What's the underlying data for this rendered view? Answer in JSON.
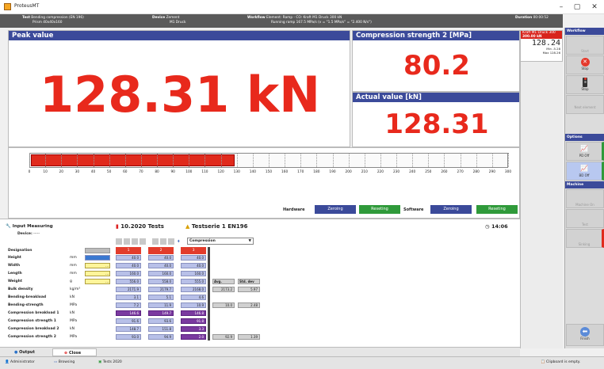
{
  "app": {
    "title": "ProteusMT"
  },
  "infobar": {
    "test_label": "Test",
    "test_value": "Bending compression (EN 196)",
    "test_sub": "Prism 40x40x160",
    "device_label": "Device",
    "device_value": "Zement",
    "device_sub": "M1 Druck",
    "workflow_label": "Workflow",
    "workflow_value": "Element: Ramp - CO: Kraft M1 Druck 300 kN",
    "workflow_sub": "Running ramp 167.5 MPa/s (v = \"1.5 MPa/s\" = \"2.400 N/s\")",
    "duration_label": "Duration",
    "duration_value": "00:00:52"
  },
  "peak": {
    "title": "Peak value",
    "value": "128.31 kN"
  },
  "compression": {
    "title": "Compression strength 2 [MPa]",
    "value": "80.2"
  },
  "actual": {
    "title": "Actual value [kN]",
    "value": "128.31"
  },
  "progress": {
    "fraction": 0.4277,
    "ticks": [
      "0",
      "10",
      "20",
      "30",
      "40",
      "50",
      "60",
      "70",
      "80",
      "90",
      "100",
      "110",
      "120",
      "130",
      "140",
      "150",
      "160",
      "170",
      "180",
      "190",
      "200",
      "210",
      "220",
      "230",
      "240",
      "250",
      "260",
      "270",
      "280",
      "290",
      "300"
    ]
  },
  "controls": {
    "hardware": "Hardware",
    "hw_zeroing": "Zeroing",
    "hw_reseting": "Reseting",
    "software": "Software",
    "sw_zeroing": "Zeroing",
    "sw_reseting": "Reseting"
  },
  "sensor": {
    "name": "Kraft M1 Druck 300",
    "range": "300.00 kN",
    "digits": "128.24",
    "min_label": "Min",
    "min": "-5.28",
    "max_label": "Max",
    "max": "128.26"
  },
  "workflow": {
    "title": "Workflow",
    "start": "Start",
    "stop1": "Stop",
    "stop2": "Stop",
    "next": "Next element",
    "options": "Options",
    "pd_off": "PD Off",
    "bd_off": "BD Off",
    "machine": "Machine",
    "machine_on": "Machine On",
    "test": "Test",
    "sinking": "Sinking",
    "finish": "Finish"
  },
  "input": {
    "title": "Input Measuring",
    "device_label": "Device:",
    "device_value": "-----"
  },
  "tests": {
    "title": "10.2020 Tests",
    "series": "Testserie 1 EN196",
    "time": "14:06",
    "dropdown": "Compression"
  },
  "table": {
    "designation": "Designation",
    "cols": [
      "1",
      "2",
      "3"
    ],
    "avg": "Avg.",
    "std": "Std. dev",
    "rows": [
      {
        "label": "Height",
        "unit": "mm",
        "v": [
          "40.0",
          "40.0",
          "40.0"
        ],
        "avg": "",
        "std": ""
      },
      {
        "label": "Width",
        "unit": "mm",
        "v": [
          "40.0",
          "40.0",
          "40.0"
        ],
        "avg": "",
        "std": ""
      },
      {
        "label": "Length",
        "unit": "mm",
        "v": [
          "160.0",
          "160.0",
          "160.0"
        ],
        "avg": "",
        "std": ""
      },
      {
        "label": "Weight",
        "unit": "g",
        "v": [
          "556.0",
          "558.0",
          "555.0"
        ],
        "avg": "",
        "std": ""
      },
      {
        "label": "Bulk density",
        "unit": "kg/m³",
        "v": [
          "2171.9",
          "2179.7",
          "2168.0"
        ],
        "avg": "2173.2",
        "std": "5.97"
      },
      {
        "label": "Bending-breakload",
        "unit": "kN",
        "v": [
          "3.1",
          "5.1",
          "4.6"
        ],
        "avg": "",
        "std": ""
      },
      {
        "label": "Bending-strength",
        "unit": "MPa",
        "v": [
          "7.2",
          "11.9",
          "10.9"
        ],
        "avg": "10.0",
        "std": "2.48"
      },
      {
        "label": "Compression breakload 1",
        "unit": "kN",
        "v": [
          "146.6",
          "149.7",
          "146.8"
        ],
        "avg": "",
        "std": ""
      },
      {
        "label": "Compression strength 1",
        "unit": "MPa",
        "v": [
          "91.6",
          "93.6",
          "91.8"
        ],
        "avg": "",
        "std": ""
      },
      {
        "label": "Compression breakload 2",
        "unit": "kN",
        "v": [
          "148.7",
          "151.8",
          "3.3"
        ],
        "avg": "",
        "std": ""
      },
      {
        "label": "Compression strength 2",
        "unit": "MPa",
        "v": [
          "93.0",
          "94.9",
          "2.0"
        ],
        "avg": "92.9",
        "std": "1.39"
      }
    ]
  },
  "tabs": {
    "output": "Output",
    "close": "Close"
  },
  "status": {
    "user": "Administrator",
    "mode": "Browsing",
    "tests": "Tests 2020",
    "clipboard": "Clipboard is empty."
  }
}
